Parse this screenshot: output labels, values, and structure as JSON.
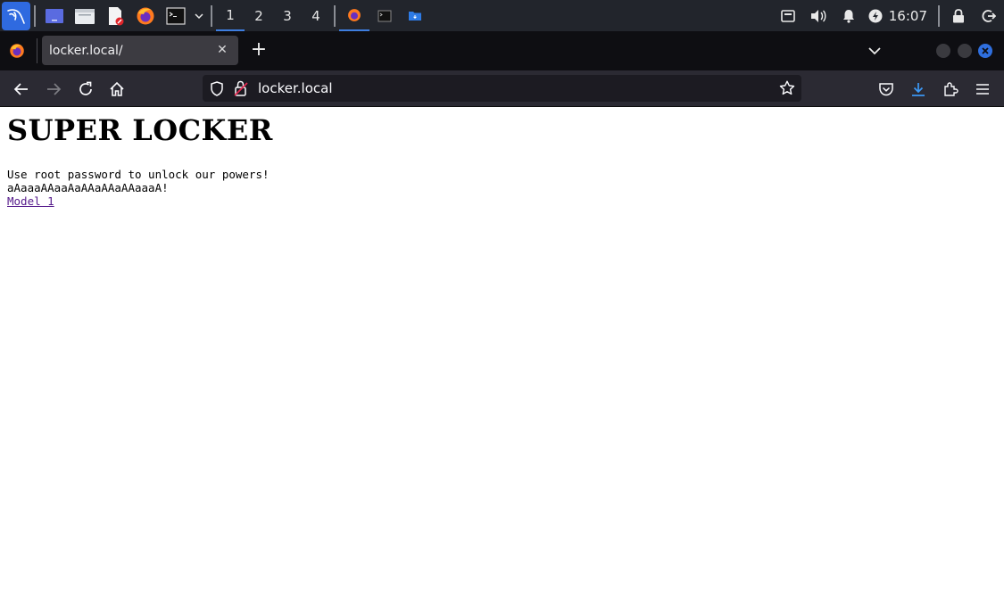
{
  "taskbar": {
    "workspaces": [
      "1",
      "2",
      "3",
      "4"
    ],
    "active_workspace": "1",
    "clock": "16:07",
    "apps": [
      "kali-menu-icon",
      "desktop-icon",
      "file-manager-icon",
      "text-editor-icon",
      "firefox-icon",
      "terminal-icon"
    ],
    "accent": "#3e7ee0"
  },
  "browser": {
    "tab_title": "locker.local/",
    "url": "locker.local"
  },
  "page": {
    "heading": "SUPER LOCKER",
    "line1": "Use root password to unlock our powers!",
    "line2": "aAaaaAAaaAaAAaAAaAAaaaA!",
    "link": "Model 1"
  }
}
